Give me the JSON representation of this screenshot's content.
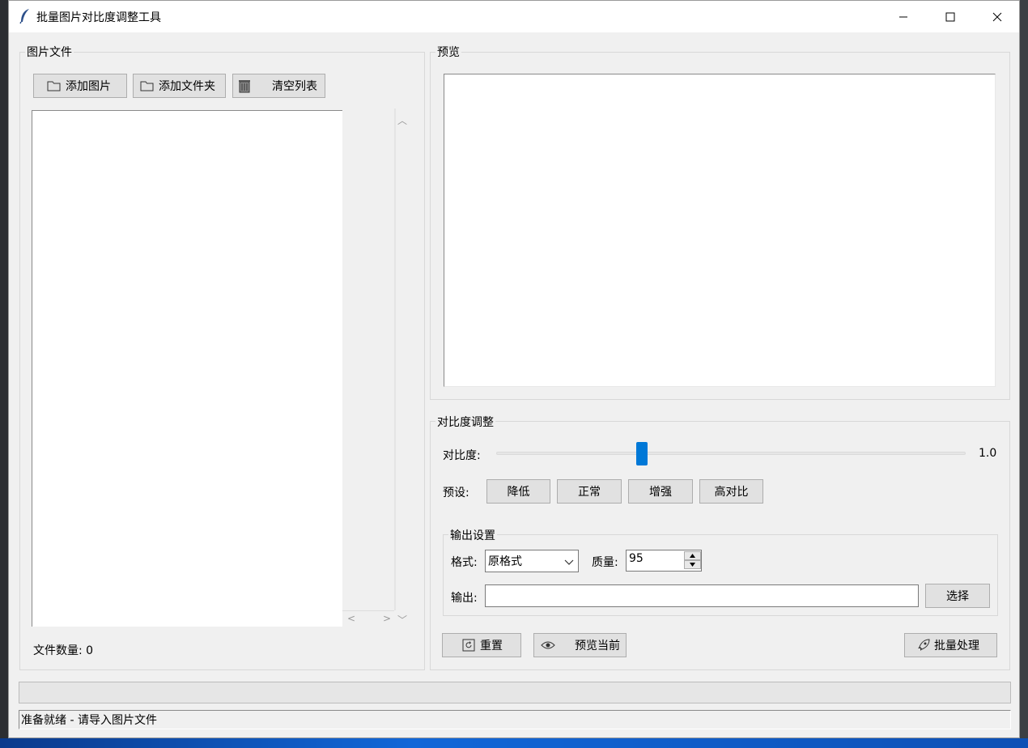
{
  "window": {
    "title": "批量图片对比度调整工具"
  },
  "files_panel": {
    "title": "图片文件",
    "add_image_label": "添加图片",
    "add_folder_label": "添加文件夹",
    "clear_list_label": "清空列表",
    "file_count_text": "文件数量: 0"
  },
  "preview_panel": {
    "title": "预览"
  },
  "contrast_panel": {
    "title": "对比度调整",
    "contrast_label": "对比度:",
    "contrast_value_text": "1.0",
    "contrast_value": 1.0,
    "slider_fraction": 0.31,
    "preset_label": "预设:",
    "presets": [
      "降低",
      "正常",
      "增强",
      "高对比"
    ]
  },
  "output_settings": {
    "title": "输出设置",
    "format_label": "格式:",
    "format_value": "原格式",
    "quality_label": "质量:",
    "quality_value": "95",
    "output_label": "输出:",
    "output_value": "",
    "choose_label": "选择"
  },
  "actions": {
    "reset_label": "重置",
    "preview_current_label": "预览当前",
    "batch_label": "批量处理"
  },
  "status": {
    "text": "准备就绪 - 请导入图片文件",
    "progress": 0
  },
  "icons": {
    "app": "feather-icon",
    "add_image": "folder-icon",
    "add_folder": "folder-icon",
    "clear": "trash-icon",
    "reset": "refresh-icon",
    "preview": "eye-icon",
    "batch": "rocket-icon"
  },
  "colors": {
    "accent": "#0078d7",
    "window_bg": "#f0f0f0"
  }
}
